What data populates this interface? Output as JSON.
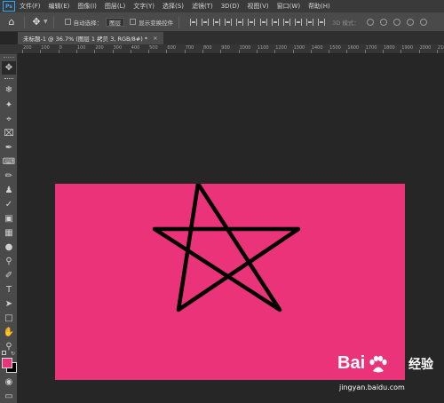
{
  "app": {
    "logo": "Ps"
  },
  "menu": [
    "文件(F)",
    "编辑(E)",
    "图像(I)",
    "图层(L)",
    "文字(Y)",
    "选择(S)",
    "滤镜(T)",
    "3D(D)",
    "视图(V)",
    "窗口(W)",
    "帮助(H)"
  ],
  "options": {
    "auto_select_label": "自动选择：",
    "auto_select_value": "图层",
    "show_transform_label": "显示变换控件",
    "mode_3d_label": "3D 模式："
  },
  "document": {
    "tab_title": "未标题-1 @ 36.7% (图层 1 拷贝 3, RGB/8#) *",
    "close_glyph": "×",
    "background_color": "#ea3378",
    "shape_color": "#000000"
  },
  "ruler": {
    "labels": [
      "200",
      "100",
      "0",
      "100",
      "200",
      "300",
      "400",
      "500",
      "600",
      "700",
      "800",
      "900",
      "1000",
      "1100",
      "1200",
      "1300",
      "1400",
      "1500",
      "1600",
      "1700",
      "1800",
      "1900",
      "2000",
      "2100"
    ]
  },
  "toolbar": {
    "tools": [
      "move-tool",
      "marquee-tool",
      "lasso-tool",
      "magic-wand-tool",
      "crop-tool",
      "frame-tool",
      "eyedropper-tool",
      "healing-brush-tool",
      "brush-tool",
      "clone-stamp-tool",
      "history-brush-tool",
      "eraser-tool",
      "gradient-tool",
      "blur-tool",
      "dodge-tool",
      "pen-tool",
      "type-tool",
      "path-selection-tool",
      "rectangle-tool",
      "hand-tool",
      "zoom-tool"
    ],
    "foreground_color": "#ea3378",
    "background_color": "#000000"
  },
  "watermark": {
    "logo_text": "Bai",
    "logo_suffix": "经验",
    "url": "jingyan.baidu.com"
  }
}
